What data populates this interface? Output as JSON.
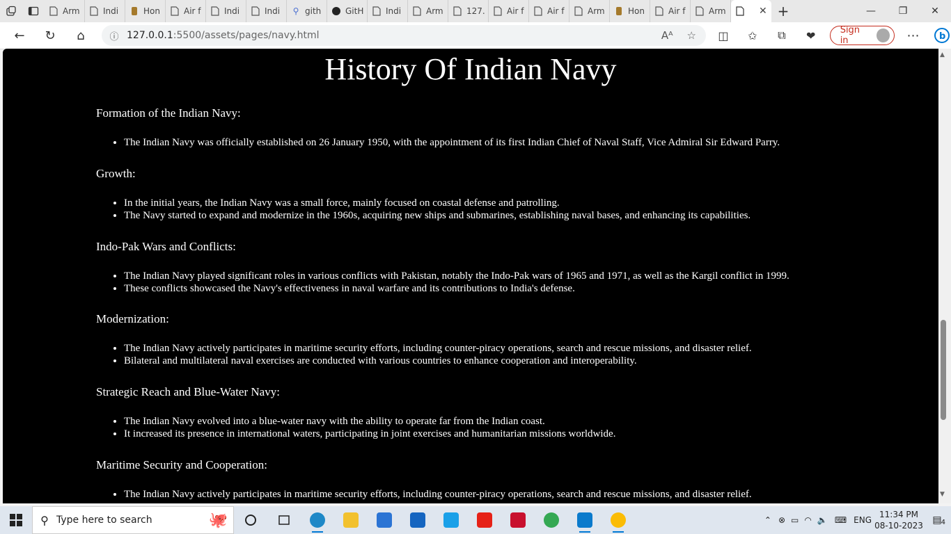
{
  "browser": {
    "tabs": [
      {
        "label": "Arm",
        "icon": "page-icon"
      },
      {
        "label": "Indi",
        "icon": "page-icon"
      },
      {
        "label": "Hon",
        "icon": "emblem-icon"
      },
      {
        "label": "Air f",
        "icon": "page-icon"
      },
      {
        "label": "Indi",
        "icon": "page-icon"
      },
      {
        "label": "Indi",
        "icon": "page-icon"
      },
      {
        "label": "gith",
        "icon": "search-icon"
      },
      {
        "label": "GitH",
        "icon": "github-icon"
      },
      {
        "label": "Indi",
        "icon": "page-icon"
      },
      {
        "label": "Arm",
        "icon": "page-icon"
      },
      {
        "label": "127.",
        "icon": "page-icon"
      },
      {
        "label": "Air f",
        "icon": "page-icon"
      },
      {
        "label": "Air f",
        "icon": "page-icon"
      },
      {
        "label": "Arm",
        "icon": "page-icon"
      },
      {
        "label": "Hon",
        "icon": "emblem-icon"
      },
      {
        "label": "Air f",
        "icon": "page-icon"
      },
      {
        "label": "Arm",
        "icon": "page-icon"
      }
    ],
    "url_host": "127.0.0.1",
    "url_rest": ":5500/assets/pages/navy.html",
    "sign_in": "Sign in"
  },
  "page": {
    "title": "History Of Indian Navy",
    "sections": [
      {
        "heading": "Formation of the Indian Navy:",
        "items": [
          "The Indian Navy was officially established on 26 January 1950, with the appointment of its first Indian Chief of Naval Staff, Vice Admiral Sir Edward Parry."
        ]
      },
      {
        "heading": "Growth:",
        "items": [
          "In the initial years, the Indian Navy was a small force, mainly focused on coastal defense and patrolling.",
          "The Navy started to expand and modernize in the 1960s, acquiring new ships and submarines, establishing naval bases, and enhancing its capabilities."
        ]
      },
      {
        "heading": "Indo-Pak Wars and Conflicts:",
        "items": [
          "The Indian Navy played significant roles in various conflicts with Pakistan, notably the Indo-Pak wars of 1965 and 1971, as well as the Kargil conflict in 1999.",
          "These conflicts showcased the Navy's effectiveness in naval warfare and its contributions to India's defense."
        ]
      },
      {
        "heading": "Modernization:",
        "items": [
          "The Indian Navy actively participates in maritime security efforts, including counter-piracy operations, search and rescue missions, and disaster relief.",
          "Bilateral and multilateral naval exercises are conducted with various countries to enhance cooperation and interoperability."
        ]
      },
      {
        "heading": "Strategic Reach and Blue-Water Navy:",
        "items": [
          "The Indian Navy evolved into a blue-water navy with the ability to operate far from the Indian coast.",
          "It increased its presence in international waters, participating in joint exercises and humanitarian missions worldwide."
        ]
      },
      {
        "heading": "Maritime Security and Cooperation:",
        "items": [
          "The Indian Navy actively participates in maritime security efforts, including counter-piracy operations, search and rescue missions, and disaster relief."
        ]
      }
    ]
  },
  "taskbar": {
    "search_placeholder": "Type here to search",
    "lang": "ENG",
    "time": "11:34 PM",
    "date": "08-10-2023",
    "notifications": "4"
  },
  "colors": {
    "accent": "#0078d4",
    "signin": "#c42b1c",
    "page_bg": "#000000"
  }
}
